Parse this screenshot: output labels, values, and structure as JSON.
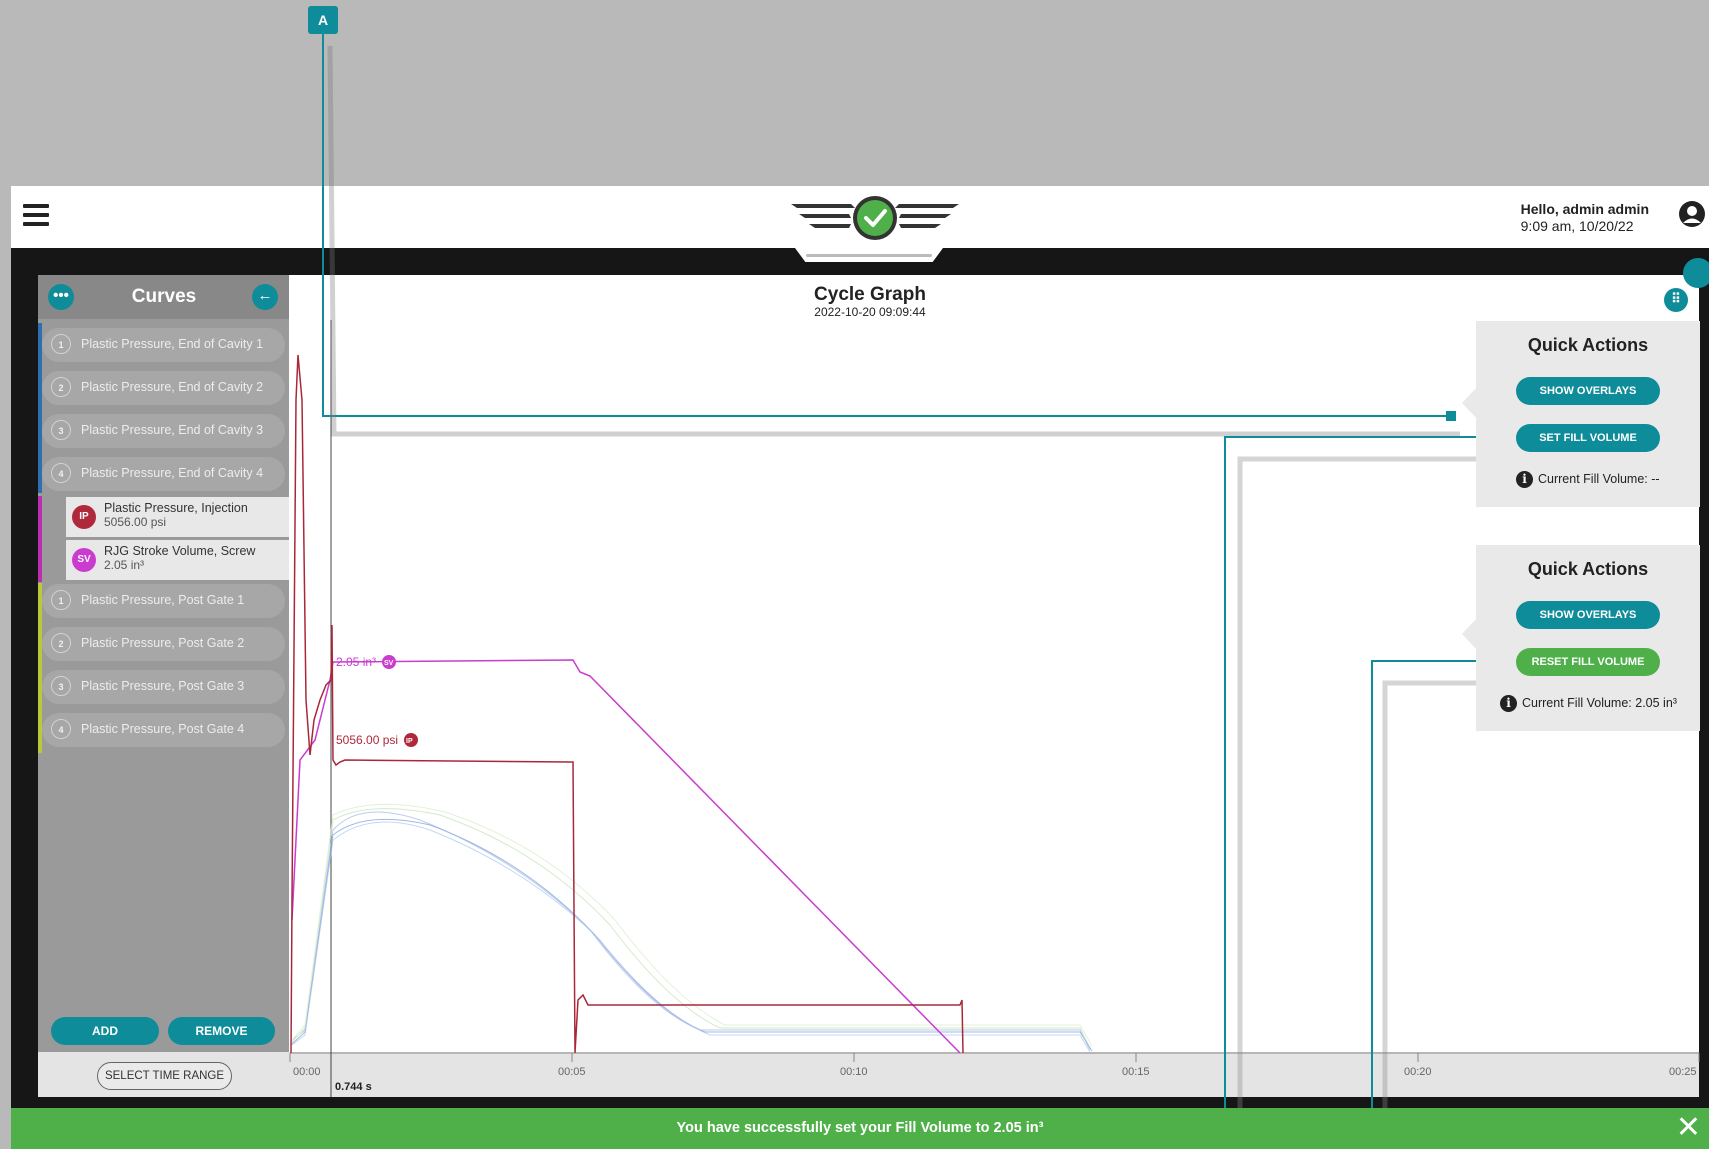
{
  "header": {
    "greeting": "Hello, admin admin",
    "datetime": "9:09 am, 10/20/22"
  },
  "panel": {
    "title": "Curves",
    "curves_group1": [
      {
        "num": "1",
        "label": "Plastic Pressure, End of Cavity 1"
      },
      {
        "num": "2",
        "label": "Plastic Pressure, End of Cavity 2"
      },
      {
        "num": "3",
        "label": "Plastic Pressure, End of Cavity 3"
      },
      {
        "num": "4",
        "label": "Plastic Pressure, End of Cavity 4"
      }
    ],
    "selected": [
      {
        "badge": "IP",
        "label": "Plastic Pressure, Injection",
        "value": "5056.00 psi",
        "color": "#b0283b"
      },
      {
        "badge": "SV",
        "label": "RJG Stroke Volume, Screw",
        "value": "2.05 in³",
        "color": "#c93ccf"
      }
    ],
    "curves_group2": [
      {
        "num": "1",
        "label": "Plastic Pressure, Post Gate 1"
      },
      {
        "num": "2",
        "label": "Plastic Pressure, Post Gate 2"
      },
      {
        "num": "3",
        "label": "Plastic Pressure, Post Gate 3"
      },
      {
        "num": "4",
        "label": "Plastic Pressure, Post Gate 4"
      }
    ],
    "add_label": "ADD",
    "remove_label": "REMOVE",
    "time_range_label": "SELECT TIME RANGE"
  },
  "graph": {
    "title": "Cycle Graph",
    "timestamp": "2022-10-20   09:09:44",
    "x_ticks": [
      "00:00",
      "00:05",
      "00:10",
      "00:15",
      "00:20",
      "00:25"
    ],
    "cursor_label": "0.744 s",
    "sv_annotation": "2.05 in³",
    "sv_badge": "SV",
    "ip_annotation": "5056.00 psi",
    "ip_badge": "IP"
  },
  "quick_actions_1": {
    "title": "Quick Actions",
    "show_overlays": "SHOW OVERLAYS",
    "fill_button": "SET FILL VOLUME",
    "info_label": "Current Fill Volume:",
    "info_value": "--"
  },
  "quick_actions_2": {
    "title": "Quick Actions",
    "show_overlays": "SHOW OVERLAYS",
    "fill_button": "RESET FILL VOLUME",
    "info_label": "Current Fill Volume:",
    "info_value": "2.05 in³"
  },
  "toast": {
    "message": "You have successfully set your Fill Volume to 2.05 in³"
  },
  "callout": {
    "marker": "A"
  },
  "colors": {
    "teal": "#0f8c99",
    "green": "#4fb04a",
    "ip": "#b0283b",
    "sv": "#c93ccf"
  }
}
